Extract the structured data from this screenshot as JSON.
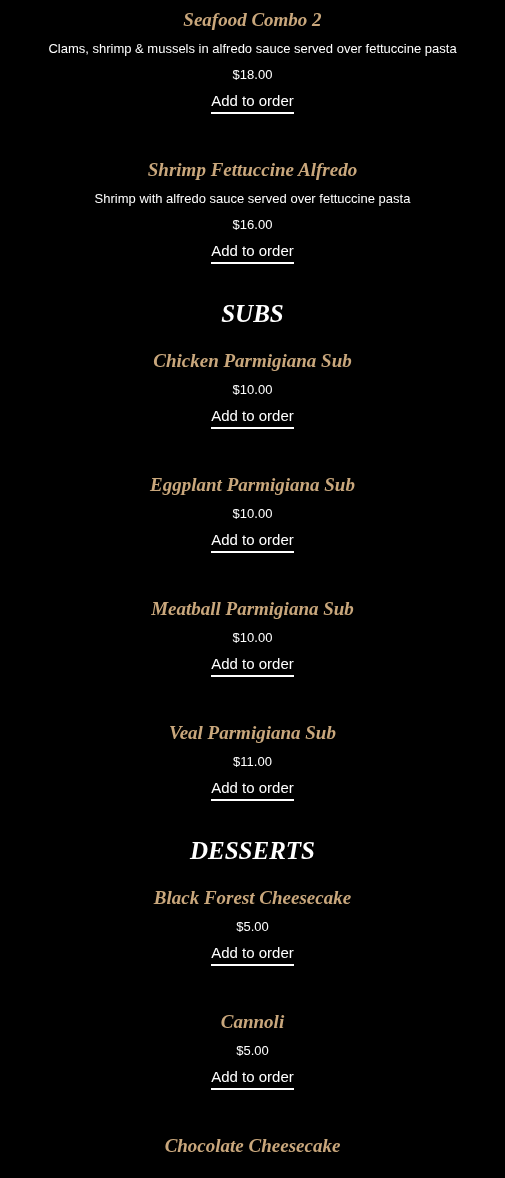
{
  "sections": [
    {
      "items": [
        {
          "name": "Seafood Combo 2",
          "description": "Clams, shrimp & mussels in alfredo sauce served over fettuccine pasta",
          "price": "$18.00",
          "button": "Add to order"
        },
        {
          "name": "Shrimp Fettuccine Alfredo",
          "description": "Shrimp with alfredo sauce served over fettuccine pasta",
          "price": "$16.00",
          "button": "Add to order"
        }
      ]
    },
    {
      "heading": "SUBS",
      "items": [
        {
          "name": "Chicken Parmigiana Sub",
          "price": "$10.00",
          "button": "Add to order"
        },
        {
          "name": "Eggplant Parmigiana Sub",
          "price": "$10.00",
          "button": "Add to order"
        },
        {
          "name": "Meatball Parmigiana Sub",
          "price": "$10.00",
          "button": "Add to order"
        },
        {
          "name": "Veal Parmigiana Sub",
          "price": "$11.00",
          "button": "Add to order"
        }
      ]
    },
    {
      "heading": "DESSERTS",
      "items": [
        {
          "name": "Black Forest Cheesecake",
          "price": "$5.00",
          "button": "Add to order"
        },
        {
          "name": "Cannoli",
          "price": "$5.00",
          "button": "Add to order"
        },
        {
          "name": "Chocolate Cheesecake"
        }
      ]
    }
  ]
}
